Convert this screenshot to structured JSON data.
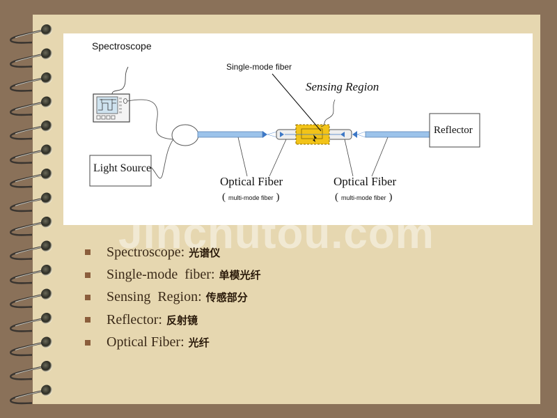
{
  "slide": {
    "background_color": "#8a7159",
    "card_color": "#e6d7b0",
    "watermark": "Jinchutou.com"
  },
  "diagram": {
    "spectroscope_label": "Spectroscope",
    "single_mode_fiber_label": "Single-mode fiber",
    "sensing_region_label": "Sensing Region",
    "light_source_label": "Light Source",
    "reflector_label": "Reflector",
    "optical_fiber_left": {
      "label": "Optical Fiber",
      "sublabel_open": "(",
      "sublabel": "multi-mode fiber",
      "sublabel_close": ")"
    },
    "optical_fiber_right": {
      "label": "Optical Fiber",
      "sublabel_open": "(",
      "sublabel": "multi-mode fiber",
      "sublabel_close": ")"
    },
    "fiber_color": "#9cc3ea",
    "sensing_color": "#f2c318"
  },
  "glossary": [
    {
      "term": "Spectroscope",
      "sep": ":",
      "translation": "光谱仪"
    },
    {
      "term": "Single-mode  fiber",
      "sep": ":",
      "translation": "单模光纤"
    },
    {
      "term": "Sensing  Region",
      "sep": ":",
      "translation": "传感部分"
    },
    {
      "term": "Reflector",
      "sep": ":",
      "translation": "反射镜"
    },
    {
      "term": "Optical Fiber",
      "sep": ":",
      "translation": "光纤"
    }
  ]
}
